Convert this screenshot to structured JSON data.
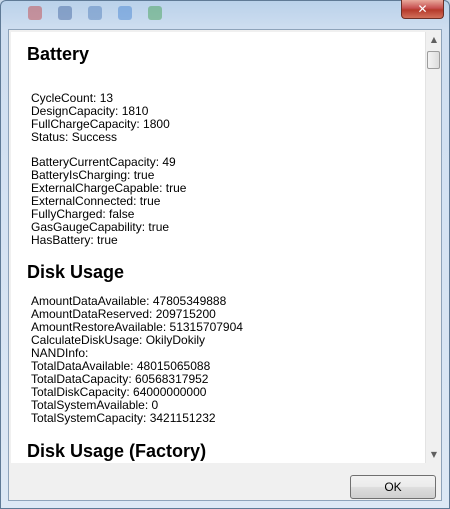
{
  "window": {
    "close_label": "✕"
  },
  "sections": {
    "battery": {
      "title": "Battery",
      "lines": [
        "CycleCount: 13",
        "DesignCapacity: 1810",
        "FullChargeCapacity: 1800",
        "Status: Success",
        "BatteryCurrentCapacity: 49",
        "BatteryIsCharging: true",
        "ExternalChargeCapable: true",
        "ExternalConnected: true",
        "FullyCharged: false",
        "GasGaugeCapability: true",
        "HasBattery: true"
      ]
    },
    "disk_usage": {
      "title": "Disk Usage",
      "lines": [
        "AmountDataAvailable: 47805349888",
        "AmountDataReserved: 209715200",
        "AmountRestoreAvailable: 51315707904",
        "CalculateDiskUsage: OkilyDokily",
        "NANDInfo:",
        "TotalDataAvailable: 48015065088",
        "TotalDataCapacity: 60568317952",
        "TotalDiskCapacity: 64000000000",
        "TotalSystemAvailable: 0",
        "TotalSystemCapacity: 3421151232"
      ]
    },
    "disk_usage_factory": {
      "title": "Disk Usage (Factory)"
    }
  },
  "buttons": {
    "ok_label": "OK"
  },
  "scrollbar": {
    "up_icon": "▲",
    "down_icon": "▼"
  }
}
